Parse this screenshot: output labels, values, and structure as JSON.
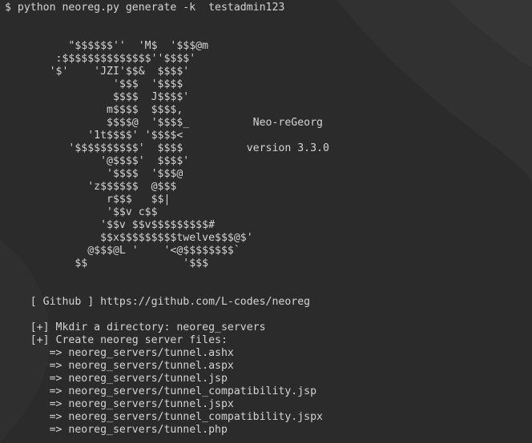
{
  "terminal": {
    "lines": [
      "$ python neoreg.py generate -k  testadmin123",
      "",
      "",
      "          \"$$$$$$''  'M$  '$$$@m",
      "        :$$$$$$$$$$$$$$''$$$$'",
      "       '$'    'JZI'$$&  $$$$'",
      "                 '$$$  '$$$$",
      "                 $$$$  J$$$$'",
      "                m$$$$  $$$$,",
      "                $$$$@  '$$$$_          Neo-reGeorg",
      "             '1t$$$$' '$$$$<",
      "          '$$$$$$$$$$'  $$$$          version 3.3.0",
      "               '@$$$$'  $$$$'",
      "                '$$$$  '$$$@",
      "             'z$$$$$$  @$$$",
      "                r$$$   $$|",
      "                '$$v c$$",
      "               '$$v $$v$$$$$$$$$#",
      "               $$x$$$$$$$$$twelve$$$@$'",
      "             @$$$@L '    '<@$$$$$$$$`",
      "           $$               '$$$",
      "",
      "",
      "    [ Github ] https://github.com/L-codes/neoreg",
      "",
      "    [+] Mkdir a directory: neoreg_servers",
      "    [+] Create neoreg server files:",
      "       => neoreg_servers/tunnel.ashx",
      "       => neoreg_servers/tunnel.aspx",
      "       => neoreg_servers/tunnel.jsp",
      "       => neoreg_servers/tunnel_compatibility.jsp",
      "       => neoreg_servers/tunnel.jspx",
      "       => neoreg_servers/tunnel_compatibility.jspx",
      "       => neoreg_servers/tunnel.php"
    ]
  },
  "colors": {
    "background": "#2b2b2b",
    "text": "#d4d4d4"
  }
}
